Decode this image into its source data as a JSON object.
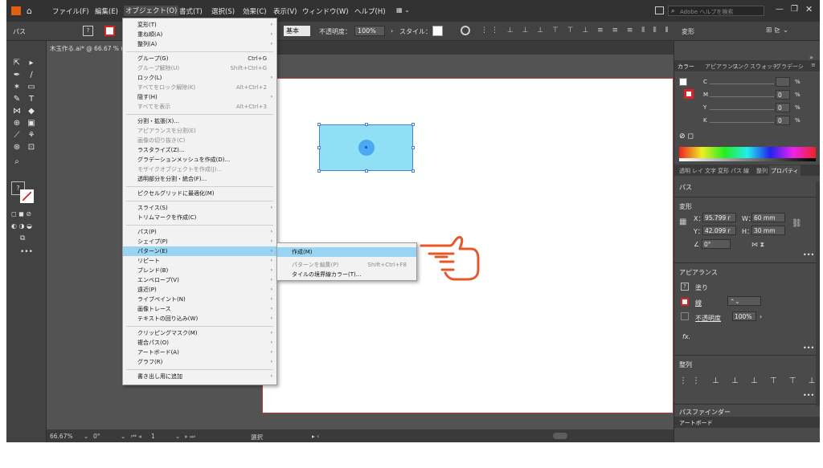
{
  "menubar": {
    "items": [
      "ファイル(F)",
      "編集(E)",
      "オブジェクト(O)",
      "書式(T)",
      "選択(S)",
      "効果(C)",
      "表示(V)",
      "ウィンドウ(W)",
      "ヘルプ(H)"
    ],
    "search_placeholder": "Adobe ヘルプを検索"
  },
  "controlbar": {
    "selection_label": "パス",
    "stroke_style": "基本",
    "opacity_label": "不透明度：",
    "opacity_value": "100%",
    "style_label": "スタイル：",
    "transform_label": "変形"
  },
  "document": {
    "tab_title": "木玉作る.ai* @ 66.67 % (R"
  },
  "statusbar": {
    "zoom": "66.67%",
    "rotation": "0°",
    "artboard_number": "1",
    "tool_name": "選択"
  },
  "object_menu": {
    "items": [
      {
        "label": "変形(T)",
        "shortcut": "",
        "submenu": true,
        "disabled": false
      },
      {
        "label": "重ね順(A)",
        "shortcut": "",
        "submenu": true,
        "disabled": false
      },
      {
        "label": "整列(A)",
        "shortcut": "",
        "submenu": true,
        "disabled": false
      },
      {
        "label": "グループ(G)",
        "shortcut": "Ctrl+G",
        "submenu": false,
        "disabled": false
      },
      {
        "label": "グループ解除(U)",
        "shortcut": "Shift+Ctrl+G",
        "submenu": false,
        "disabled": true
      },
      {
        "label": "ロック(L)",
        "shortcut": "",
        "submenu": true,
        "disabled": false
      },
      {
        "label": "すべてをロック解除(K)",
        "shortcut": "Alt+Ctrl+2",
        "submenu": false,
        "disabled": true
      },
      {
        "label": "隠す(H)",
        "shortcut": "",
        "submenu": true,
        "disabled": false
      },
      {
        "label": "すべてを表示",
        "shortcut": "Alt+Ctrl+3",
        "submenu": false,
        "disabled": true
      },
      {
        "label": "分割・拡張(X)...",
        "shortcut": "",
        "submenu": false,
        "disabled": false
      },
      {
        "label": "アピアランスを分割(E)",
        "shortcut": "",
        "submenu": false,
        "disabled": true
      },
      {
        "label": "画像の切り抜き(C)",
        "shortcut": "",
        "submenu": false,
        "disabled": true
      },
      {
        "label": "ラスタライズ(Z)...",
        "shortcut": "",
        "submenu": false,
        "disabled": false
      },
      {
        "label": "グラデーションメッシュを作成(D)...",
        "shortcut": "",
        "submenu": false,
        "disabled": false
      },
      {
        "label": "モザイクオブジェクトを作成(J)...",
        "shortcut": "",
        "submenu": false,
        "disabled": true
      },
      {
        "label": "透明部分を分割・統合(F)...",
        "shortcut": "",
        "submenu": false,
        "disabled": false
      },
      {
        "label": "ピクセルグリッドに最適化(M)",
        "shortcut": "",
        "submenu": false,
        "disabled": false
      },
      {
        "label": "スライス(S)",
        "shortcut": "",
        "submenu": true,
        "disabled": false
      },
      {
        "label": "トリムマークを作成(C)",
        "shortcut": "",
        "submenu": false,
        "disabled": false
      },
      {
        "label": "パス(P)",
        "shortcut": "",
        "submenu": true,
        "disabled": false
      },
      {
        "label": "シェイプ(P)",
        "shortcut": "",
        "submenu": true,
        "disabled": false
      },
      {
        "label": "パターン(E)",
        "shortcut": "",
        "submenu": true,
        "disabled": false
      },
      {
        "label": "リピート",
        "shortcut": "",
        "submenu": true,
        "disabled": false
      },
      {
        "label": "ブレンド(B)",
        "shortcut": "",
        "submenu": true,
        "disabled": false
      },
      {
        "label": "エンベロープ(V)",
        "shortcut": "",
        "submenu": true,
        "disabled": false
      },
      {
        "label": "遠近(P)",
        "shortcut": "",
        "submenu": true,
        "disabled": false
      },
      {
        "label": "ライブペイント(N)",
        "shortcut": "",
        "submenu": true,
        "disabled": false
      },
      {
        "label": "画像トレース",
        "shortcut": "",
        "submenu": true,
        "disabled": false
      },
      {
        "label": "テキストの回り込み(W)",
        "shortcut": "",
        "submenu": true,
        "disabled": false
      },
      {
        "label": "クリッピングマスク(M)",
        "shortcut": "",
        "submenu": true,
        "disabled": false
      },
      {
        "label": "複合パス(O)",
        "shortcut": "",
        "submenu": true,
        "disabled": false
      },
      {
        "label": "アートボード(A)",
        "shortcut": "",
        "submenu": true,
        "disabled": false
      },
      {
        "label": "グラフ(R)",
        "shortcut": "",
        "submenu": true,
        "disabled": false
      },
      {
        "label": "書き出し用に追加",
        "shortcut": "",
        "submenu": true,
        "disabled": false
      }
    ]
  },
  "pattern_submenu": {
    "items": [
      {
        "label": "作成(M)",
        "shortcut": "",
        "disabled": false
      },
      {
        "label": "パターンを編集(P)",
        "shortcut": "Shift+Ctrl+F8",
        "disabled": true
      },
      {
        "label": "タイルの境界線カラー(T)...",
        "shortcut": "",
        "disabled": false
      }
    ]
  },
  "color_panel": {
    "tabs": [
      "カラー",
      "アピアランス",
      "リンク",
      "スウォッチ",
      "グラデーション"
    ],
    "channels": [
      {
        "name": "C",
        "value": ""
      },
      {
        "name": "M",
        "value": "0"
      },
      {
        "name": "Y",
        "value": "0"
      },
      {
        "name": "K",
        "value": "0"
      }
    ],
    "unit": "%"
  },
  "properties_panel": {
    "tabs": [
      "透明",
      "レイヤー",
      "文字",
      "変形",
      "パス",
      "線",
      "整列",
      "プロパティ"
    ],
    "selection_type": "パス",
    "transform_title": "変形",
    "x_label": "X：",
    "x_value": "95.799 r",
    "y_label": "Y：",
    "y_value": "42.099 r",
    "w_label": "W：",
    "w_value": "60 mm",
    "h_label": "H：",
    "h_value": "30 mm",
    "angle_value": "0°",
    "appearance_title": "アピアランス",
    "fill_label": "塗り",
    "stroke_label": "線",
    "opacity_label": "不透明度",
    "opacity_value": "100%",
    "fx_label": "fx.",
    "align_title": "整列",
    "pathfinder_title": "パスファインダー",
    "artboard_tab": "アートボード",
    "more_label": "•••"
  },
  "colors": {
    "accent_highlight": "#99d5f2",
    "shape_fill": "#8fe0f4",
    "selection_blue": "#4a7fe0",
    "pointer_orange": "#e8572a"
  },
  "icons": {
    "pointer": "hand-pointer-icon"
  }
}
